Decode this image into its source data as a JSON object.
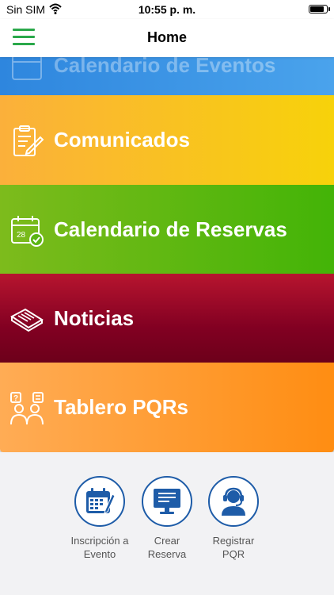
{
  "status_bar": {
    "carrier": "Sin SIM",
    "time": "10:55 p. m."
  },
  "nav": {
    "title": "Home"
  },
  "tiles": [
    {
      "label": "Calendario de Eventos",
      "icon": "calendar-icon"
    },
    {
      "label": "Comunicados",
      "icon": "clipboard-icon"
    },
    {
      "label": "Calendario de Reservas",
      "icon": "calendar-check-icon"
    },
    {
      "label": "Noticias",
      "icon": "newspaper-icon"
    },
    {
      "label": "Tablero PQRs",
      "icon": "people-question-icon"
    }
  ],
  "shortcuts": [
    {
      "line1": "Inscripción a",
      "line2": "Evento",
      "icon": "calendar-pencil-icon"
    },
    {
      "line1": "Crear",
      "line2": "Reserva",
      "icon": "monitor-icon"
    },
    {
      "line1": "Registrar",
      "line2": "PQR",
      "icon": "headset-user-icon"
    }
  ],
  "colors": {
    "accent_green": "#2aa84a",
    "shortcut_blue": "#1e5ca8"
  }
}
